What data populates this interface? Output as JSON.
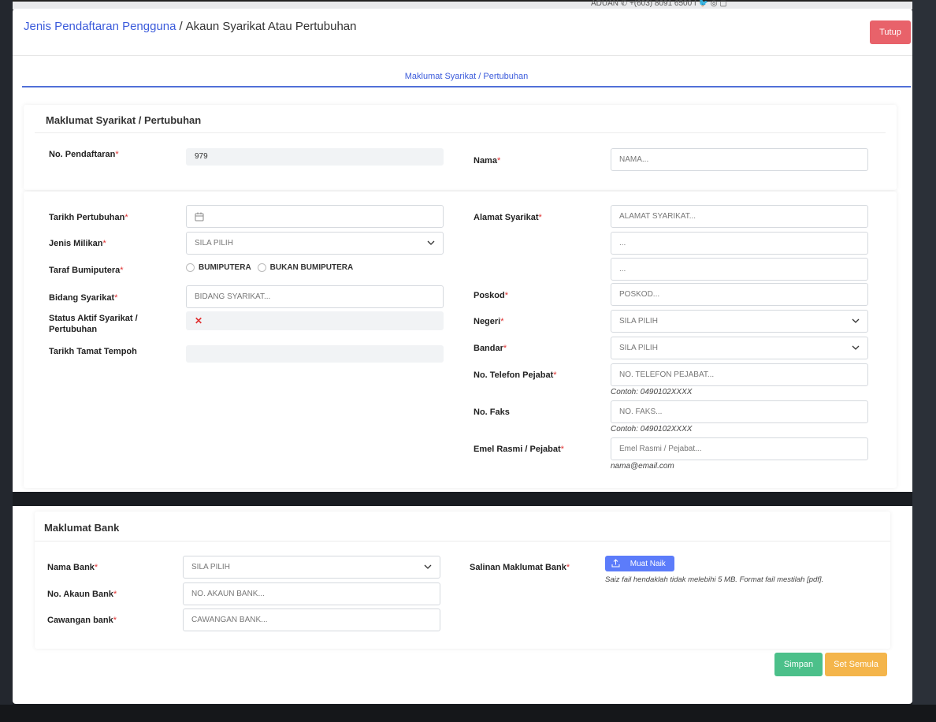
{
  "backdrop": {
    "contact_text": "ADUAN    ✆ +(603) 8091 6500    f  🐦  ◎  ▢"
  },
  "header": {
    "breadcrumb_link": "Jenis Pendaftaran Pengguna",
    "breadcrumb_sep": "/",
    "breadcrumb_current": "Akaun Syarikat Atau Pertubuhan",
    "close_label": "Tutup"
  },
  "tab": {
    "label": "Maklumat Syarikat / Pertubuhan"
  },
  "company": {
    "title": "Maklumat Syarikat / Pertubuhan",
    "reg_no_label": "No. Pendaftaran",
    "reg_no_value": "979",
    "nama_label": "Nama",
    "nama_placeholder": "NAMA...",
    "tarikh_label": "Tarikh Pertubuhan",
    "milikan_label": "Jenis Milikan",
    "milikan_value": "SILA PILIH",
    "bumi_label": "Taraf Bumiputera",
    "bumi_opt1": "BUMIPUTERA",
    "bumi_opt2": "BUKAN BUMIPUTERA",
    "bidang_label": "Bidang Syarikat",
    "bidang_placeholder": "BIDANG SYARIKAT...",
    "status_label_1": "Status Aktif Syarikat /",
    "status_label_2": "Pertubuhan",
    "status_value": "✕",
    "tamat_label": "Tarikh Tamat Tempoh",
    "alamat_label": "Alamat Syarikat",
    "alamat_placeholder": "ALAMAT SYARIKAT...",
    "alamat2_placeholder": "...",
    "alamat3_placeholder": "...",
    "poskod_label": "Poskod",
    "poskod_placeholder": "POSKOD...",
    "negeri_label": "Negeri",
    "negeri_value": "SILA PILIH",
    "bandar_label": "Bandar",
    "bandar_value": "SILA PILIH",
    "tel_label": "No. Telefon Pejabat",
    "tel_placeholder": "NO. TELEFON PEJABAT...",
    "tel_hint": "Contoh: 0490102XXXX",
    "faks_label": "No. Faks",
    "faks_placeholder": "NO. FAKS...",
    "faks_hint": "Contoh: 0490102XXXX",
    "emel_label": "Emel Rasmi / Pejabat",
    "emel_placeholder": "Emel Rasmi / Pejabat...",
    "emel_hint": "nama@email.com",
    "required_mark": "*"
  },
  "bank": {
    "title": "Maklumat Bank",
    "nama_bank_label": "Nama Bank",
    "nama_bank_value": "SILA PILIH",
    "akaun_label": "No. Akaun Bank",
    "akaun_placeholder": "NO. AKAUN BANK...",
    "cawangan_label": "Cawangan bank",
    "cawangan_placeholder": "CAWANGAN BANK...",
    "salinan_label": "Salinan Maklumat Bank",
    "upload_label": "Muat Naik",
    "upload_hint": "Saiz fail hendaklah tidak melebihi 5 MB. Format fail mestilah [pdf]."
  },
  "footer": {
    "save_label": "Simpan",
    "reset_label": "Set Semula"
  },
  "colors": {
    "primary": "#3b5bdb",
    "danger": "#e8626a",
    "success": "#4cc08a",
    "warning": "#f4b54b"
  }
}
